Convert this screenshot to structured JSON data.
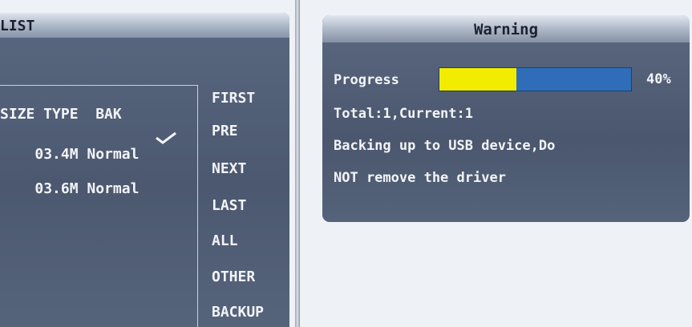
{
  "list_panel": {
    "title": "LIST",
    "columns": "SIZE TYPE  BAK",
    "rows": [
      {
        "text": "03.4M Normal",
        "bak_checked": true
      },
      {
        "text": "03.6M Normal",
        "bak_checked": false
      }
    ],
    "nav": [
      "FIRST",
      "PRE",
      "NEXT",
      "LAST",
      "ALL",
      "OTHER",
      "BACKUP"
    ]
  },
  "warning": {
    "title": "Warning",
    "progress_label": "Progress",
    "progress_fraction": 0.4,
    "progress_text": "40%",
    "counts": "Total:1,Current:1",
    "message_line1": "Backing up to USB device,Do",
    "message_line2": "NOT remove the driver"
  },
  "colors": {
    "progress_fill": "#f2ec00",
    "progress_track": "#2f6db8"
  }
}
